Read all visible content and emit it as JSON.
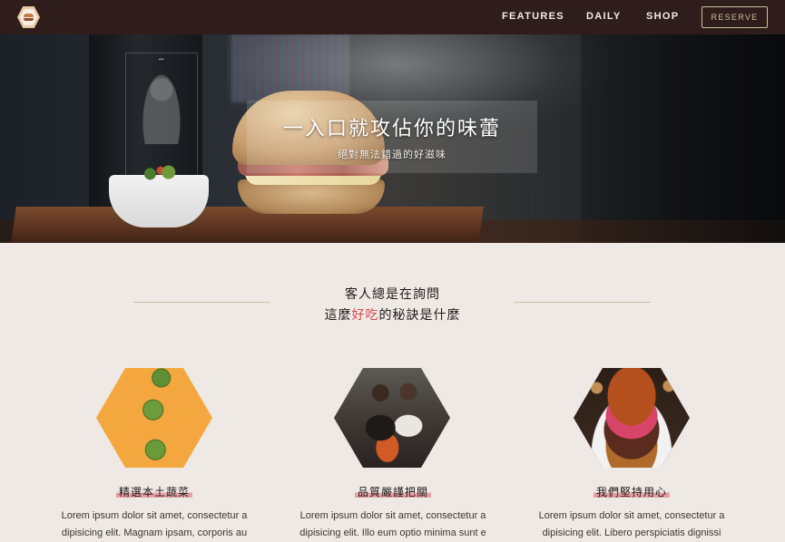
{
  "nav": {
    "links": [
      "FEATURES",
      "DAILY",
      "SHOP"
    ],
    "reserve_label": "RESERVE"
  },
  "hero": {
    "title": "一入口就攻佔你的味蕾",
    "subtitle": "絕對無法錯過的好滋味"
  },
  "section": {
    "heading_line1": "客人總是在詢問",
    "heading_line2_before": "這麼",
    "heading_line2_accent": "好吃",
    "heading_line2_after": "的秘訣是什麼"
  },
  "features": [
    {
      "title": "精選本土蔬菜",
      "text_line1": "Lorem ipsum dolor sit amet, consectetur a",
      "text_line2": "dipisicing elit. Magnam ipsam, corporis au"
    },
    {
      "title": "品質嚴謹把關",
      "text_line1": "Lorem ipsum dolor sit amet, consectetur a",
      "text_line2": "dipisicing elit. Illo eum optio minima sunt e"
    },
    {
      "title": "我們堅持用心",
      "text_line1": "Lorem ipsum dolor sit amet, consectetur a",
      "text_line2": "dipisicing elit. Libero perspiciatis dignissi"
    }
  ],
  "colors": {
    "nav_bg": "#2e1d1a",
    "page_bg": "#efe9e5",
    "accent": "#d44a4a",
    "reserve_border": "#c9c3a3"
  },
  "icons": {
    "logo": "burger-hexagon-logo"
  }
}
